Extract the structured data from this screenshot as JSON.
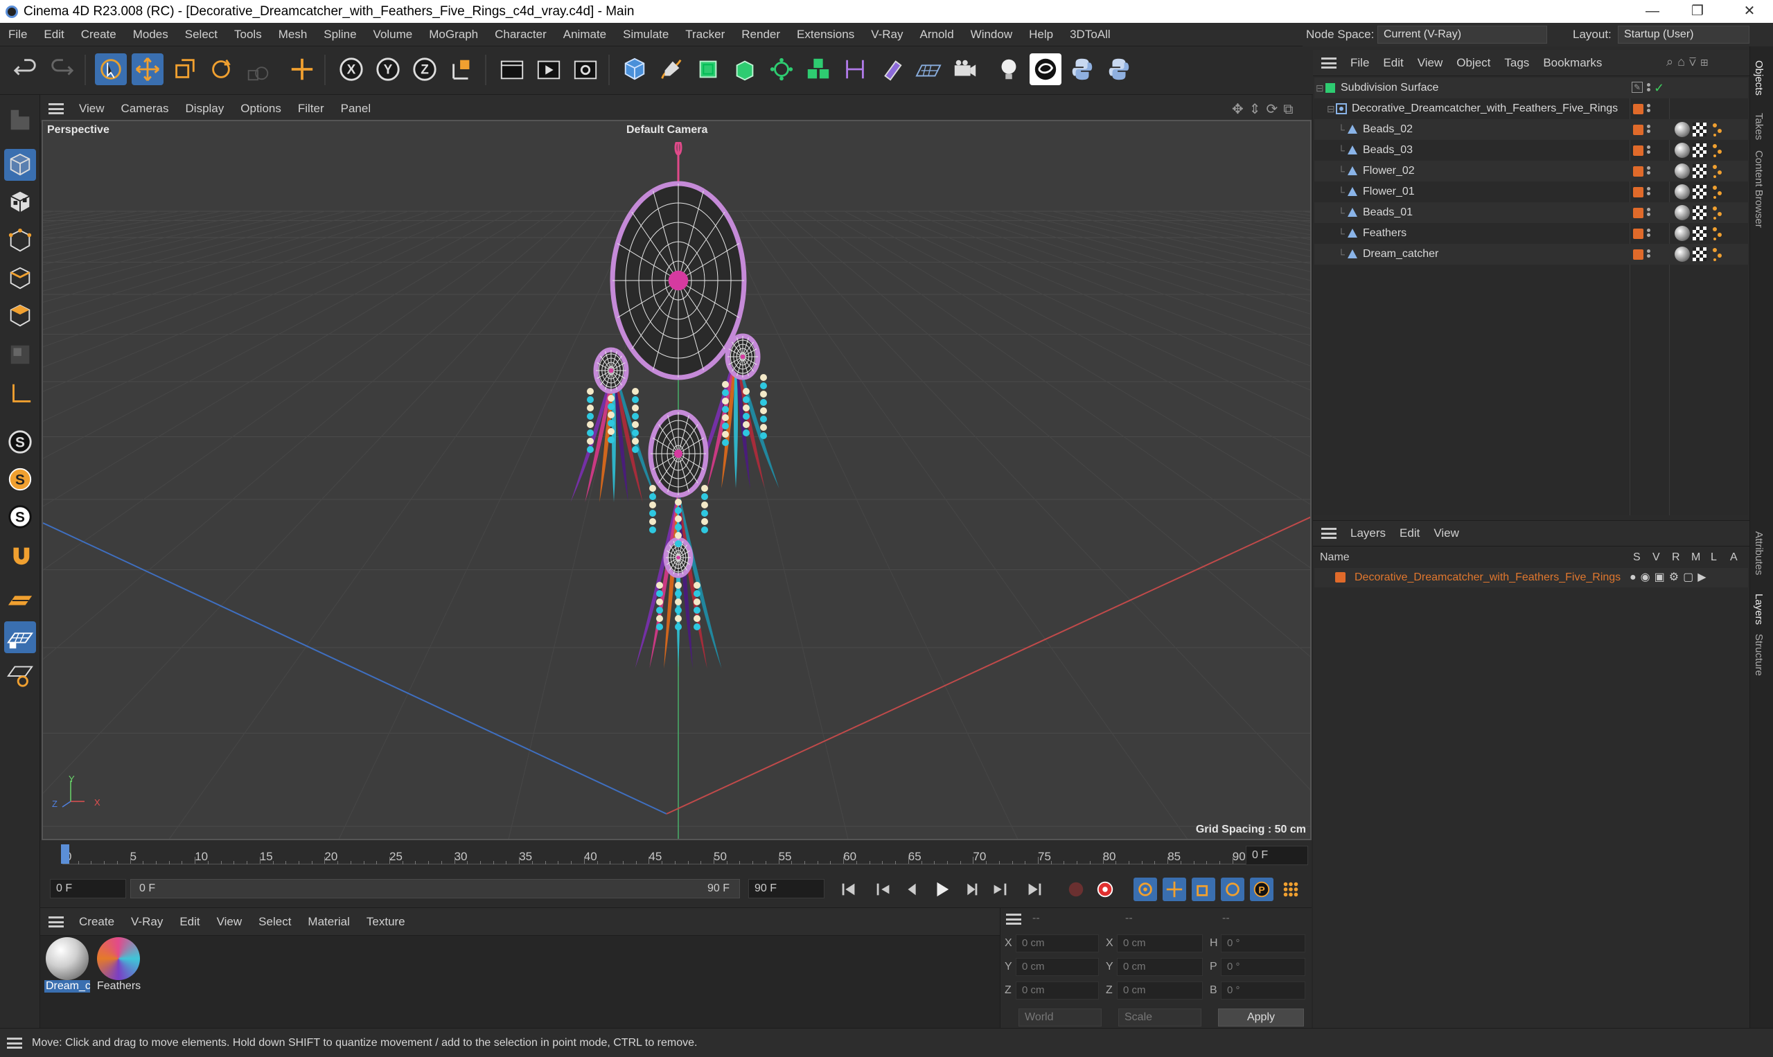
{
  "window": {
    "title": "Cinema 4D R23.008 (RC) - [Decorative_Dreamcatcher_with_Feathers_Five_Rings_c4d_vray.c4d] - Main",
    "minimize": "—",
    "maximize": "❐",
    "close": "✕"
  },
  "menu": [
    "File",
    "Edit",
    "Create",
    "Modes",
    "Select",
    "Tools",
    "Mesh",
    "Spline",
    "Volume",
    "MoGraph",
    "Character",
    "Animate",
    "Simulate",
    "Tracker",
    "Render",
    "Extensions",
    "V-Ray",
    "Arnold",
    "Window",
    "Help",
    "3DToAll"
  ],
  "node_space": {
    "label": "Node Space:",
    "value": "Current (V-Ray)"
  },
  "layout": {
    "label": "Layout:",
    "value": "Startup (User)"
  },
  "toolbar_icons": [
    "undo-icon",
    "redo-icon",
    "select-icon",
    "move-icon",
    "scale-icon",
    "rotate-icon",
    "recent-tool-icon",
    "add-object-icon",
    "x-axis-icon",
    "y-axis-icon",
    "z-axis-icon",
    "coordinate-system-icon",
    "render-region-icon",
    "render-view-icon",
    "render-settings-icon",
    "cube-icon",
    "pen-icon",
    "subdivision-icon",
    "extrude-icon",
    "cloner-icon",
    "array-icon",
    "deformer-icon",
    "paint-icon",
    "floor-icon",
    "camera-icon",
    "light-icon",
    "vray-icon",
    "python-icon",
    "python2-icon"
  ],
  "viewport": {
    "menu": [
      "View",
      "Cameras",
      "Display",
      "Options",
      "Filter",
      "Panel"
    ],
    "label": "Perspective",
    "camera": "Default Camera",
    "grid_spacing": "Grid Spacing : 50 cm",
    "axis_x": "X",
    "axis_y": "Y",
    "axis_z": "Z"
  },
  "timeline": {
    "ticks": [
      "0",
      "5",
      "10",
      "15",
      "20",
      "25",
      "30",
      "35",
      "40",
      "45",
      "50",
      "55",
      "60",
      "65",
      "70",
      "75",
      "80",
      "85",
      "90"
    ],
    "current_frame": "0 F",
    "start": "0 F",
    "range_start": "0 F",
    "range_end": "90 F",
    "end": "90 F",
    "playhead": 0
  },
  "materials": {
    "menu": [
      "Create",
      "V-Ray",
      "Edit",
      "View",
      "Select",
      "Material",
      "Texture"
    ],
    "items": [
      {
        "name": "Dream_c",
        "selected": true
      },
      {
        "name": "Feathers",
        "selected": false
      }
    ]
  },
  "coordinates": {
    "header": [
      "--",
      "--",
      "--"
    ],
    "rows": [
      {
        "a": "X",
        "av": "0 cm",
        "b": "X",
        "bv": "0 cm",
        "c": "H",
        "cv": "0 °"
      },
      {
        "a": "Y",
        "av": "0 cm",
        "b": "Y",
        "bv": "0 cm",
        "c": "P",
        "cv": "0 °"
      },
      {
        "a": "Z",
        "av": "0 cm",
        "b": "Z",
        "bv": "0 cm",
        "c": "B",
        "cv": "0 °"
      }
    ],
    "space": "World",
    "mode": "Scale",
    "apply": "Apply"
  },
  "objects": {
    "menu": [
      "File",
      "Edit",
      "View",
      "Object",
      "Tags",
      "Bookmarks"
    ],
    "rows": [
      {
        "name": "Subdivision Surface",
        "level": 0
      },
      {
        "name": "Decorative_Dreamcatcher_with_Feathers_Five_Rings",
        "level": 1
      },
      {
        "name": "Beads_02",
        "level": 2
      },
      {
        "name": "Beads_03",
        "level": 2
      },
      {
        "name": "Flower_02",
        "level": 2
      },
      {
        "name": "Flower_01",
        "level": 2
      },
      {
        "name": "Beads_01",
        "level": 2
      },
      {
        "name": "Feathers",
        "level": 2
      },
      {
        "name": "Dream_catcher",
        "level": 2
      }
    ]
  },
  "layers": {
    "menu": [
      "Layers",
      "Edit",
      "View"
    ],
    "col_name": "Name",
    "cols": [
      "S",
      "V",
      "R",
      "M",
      "L",
      "A"
    ],
    "rows": [
      {
        "name": "Decorative_Dreamcatcher_with_Feathers_Five_Rings"
      }
    ]
  },
  "side_tabs": [
    "Objects",
    "Takes",
    "Content Browser",
    "Attributes",
    "Layers",
    "Structure"
  ],
  "status": "Move: Click and drag to move elements. Hold down SHIFT to quantize movement / add to the selection in point mode, CTRL to remove.",
  "colors": {
    "accent": "#e0772e",
    "highlight": "#3a6fb0",
    "grid": "#4a4a4a"
  }
}
